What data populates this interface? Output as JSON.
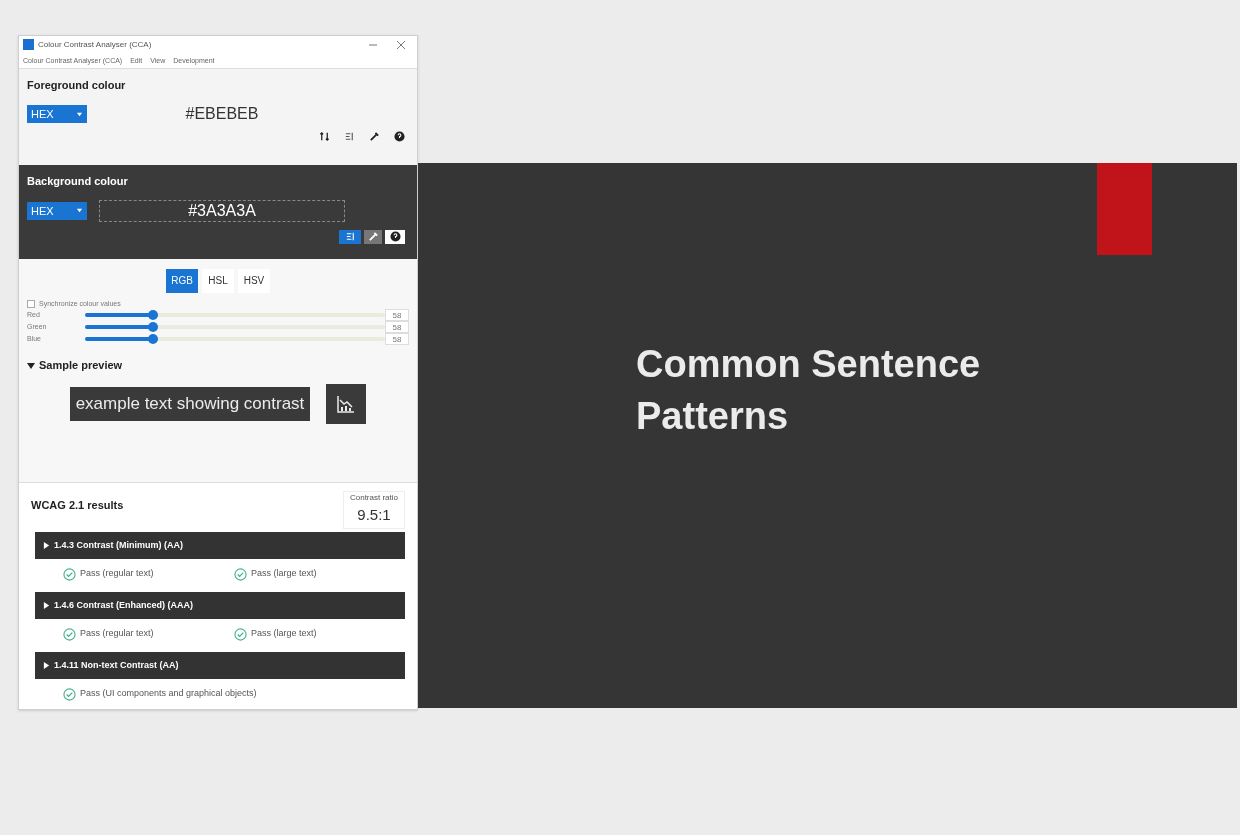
{
  "window": {
    "title": "Colour Contrast Analyser (CCA)"
  },
  "menu": [
    "Colour Contrast Analyser (CCA)",
    "Edit",
    "View",
    "Development"
  ],
  "foreground": {
    "label": "Foreground colour",
    "format": "HEX",
    "value": "#EBEBEB"
  },
  "background": {
    "label": "Background colour",
    "format": "HEX",
    "value": "#3A3A3A"
  },
  "tabs": [
    {
      "label": "RGB",
      "selected": true
    },
    {
      "label": "HSL",
      "selected": false
    },
    {
      "label": "HSV",
      "selected": false
    }
  ],
  "sync": {
    "label": "Synchronize colour values",
    "checked": false
  },
  "channels": [
    {
      "name": "Red",
      "level": 0.227,
      "value": "58"
    },
    {
      "name": "Green",
      "level": 0.227,
      "value": "58"
    },
    {
      "name": "Blue",
      "level": 0.227,
      "value": "58"
    }
  ],
  "preview": {
    "label": "Sample preview",
    "expanded": true,
    "text": "example text showing contrast"
  },
  "results": {
    "title": "WCAG 2.1 results",
    "ratio_label": "Contrast ratio",
    "ratio": "9.5:1",
    "criteria": [
      {
        "title": "1.4.3 Contrast (Minimum) (AA)",
        "checks": [
          {
            "label": "Pass (regular text)",
            "pass": true
          },
          {
            "label": "Pass (large text)",
            "pass": true
          }
        ]
      },
      {
        "title": "1.4.6 Contrast (Enhanced) (AAA)",
        "checks": [
          {
            "label": "Pass (regular text)",
            "pass": true
          },
          {
            "label": "Pass (large text)",
            "pass": true
          }
        ]
      },
      {
        "title": "1.4.11 Non-text Contrast (AA)",
        "checks": [
          {
            "label": "Pass (UI components and graphical objects)",
            "pass": true
          }
        ]
      }
    ]
  },
  "slide": {
    "title": "Common Sentence Patterns"
  }
}
